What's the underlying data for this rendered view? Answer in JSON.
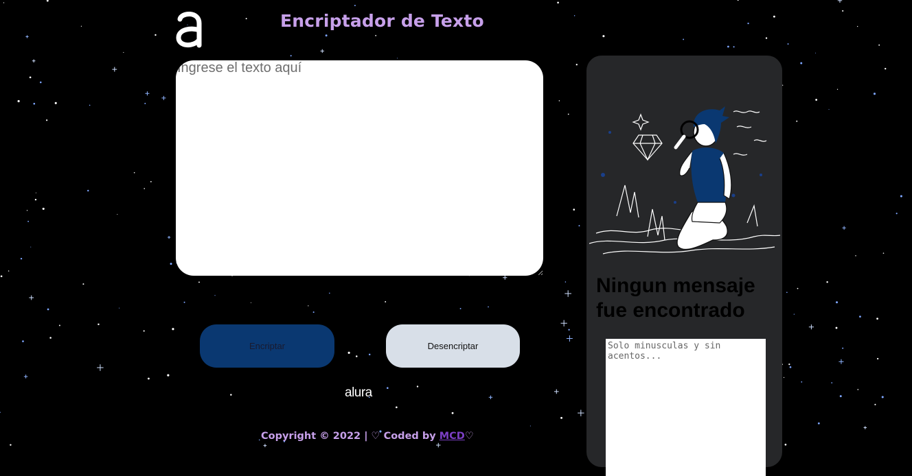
{
  "header": {
    "logo_icon": "alura-a-logo-icon",
    "title": "Encriptador de Texto"
  },
  "input": {
    "placeholder": "Ingrese el texto aquí",
    "value": ""
  },
  "buttons": {
    "encrypt_label": "Encriptar",
    "decrypt_label": "Desencriptar"
  },
  "brand": {
    "text": "alura"
  },
  "footer": {
    "text": "Copyright © 2022 | ♡ Coded by ",
    "link_text": "MCD",
    "suffix": "♡"
  },
  "result_panel": {
    "illustration_icon": "person-with-magnifying-glass-icon",
    "message": "Ningun mensaje fue encontrado",
    "output_placeholder": "Solo minusculas y sin acentos...",
    "output_value": ""
  },
  "colors": {
    "background": "#000000",
    "title": "#c7a0ea",
    "encrypt_button": "#0a3871",
    "decrypt_button": "#d8dfe8",
    "panel": "#262729",
    "link": "#7b3fc4"
  }
}
